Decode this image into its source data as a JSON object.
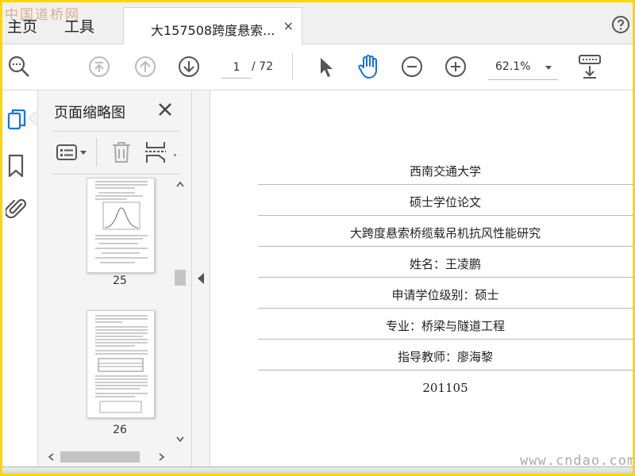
{
  "watermark": {
    "top": "中国道桥网",
    "bottom": "www.cndao.com"
  },
  "menu": {
    "home": "主页",
    "tools": "工具"
  },
  "doc_tab": {
    "title": "大157508跨度悬索...",
    "close": "×"
  },
  "toolbar": {
    "current_page": "1",
    "total_pages": "/ 72",
    "zoom": "62.1%"
  },
  "panel": {
    "title": "页面缩略图",
    "thumbnails": [
      {
        "label": "25"
      },
      {
        "label": "26"
      }
    ]
  },
  "document": {
    "lines": [
      "西南交通大学",
      "硕士学位论文",
      "大跨度悬索桥缆载吊机抗风性能研究",
      "姓名：王凌鹏",
      "申请学位级别：硕士",
      "专业：桥梁与隧道工程",
      "指导教师：廖海黎",
      "201105"
    ]
  },
  "colors": {
    "frame": "#ffd400",
    "icon": "#555555",
    "accent": "#1473e6"
  }
}
